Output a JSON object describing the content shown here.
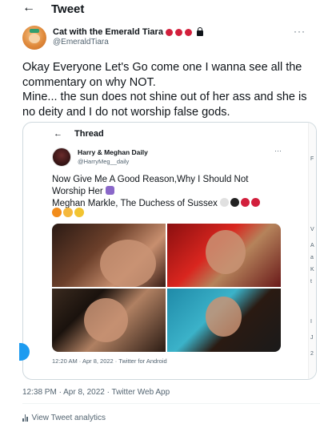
{
  "header": {
    "back_label": "←",
    "title": "Tweet"
  },
  "author": {
    "display_name": "Cat with the Emerald Tiara",
    "handle": "@EmeraldTiara",
    "more_label": "···"
  },
  "tweet": {
    "line1": "Okay Everyone Let's Go  come one I wanna see all the commentary on why NOT.",
    "line2": "Mine... the sun does not shine out of her ass and she is no deity and I do not worship false gods."
  },
  "quoted_screenshot": {
    "back_label": "←",
    "thread_title": "Thread",
    "name": "Harry & Meghan Daily",
    "handle": "@HarryMeg__daily",
    "more_label": "···",
    "text_line1": "Now Give Me A Good Reason,Why I Should Not",
    "text_line2": "Worship Her",
    "text_line3": "Meghan Markle, The Duchess of Sussex",
    "timestamp": "12:20 AM · Apr 8, 2022 · Twitter for Android",
    "right_strip_chars": [
      "F",
      "V",
      "A",
      "a",
      "K",
      "t",
      "I",
      "J",
      "2"
    ]
  },
  "meta": {
    "timestamp": "12:38 PM · Apr 8, 2022 · Twitter Web App",
    "analytics_label": "View Tweet analytics"
  },
  "colors": {
    "accent": "#1d9bf0",
    "muted": "#536471",
    "text": "#0f1419",
    "border": "#cfd9de"
  }
}
